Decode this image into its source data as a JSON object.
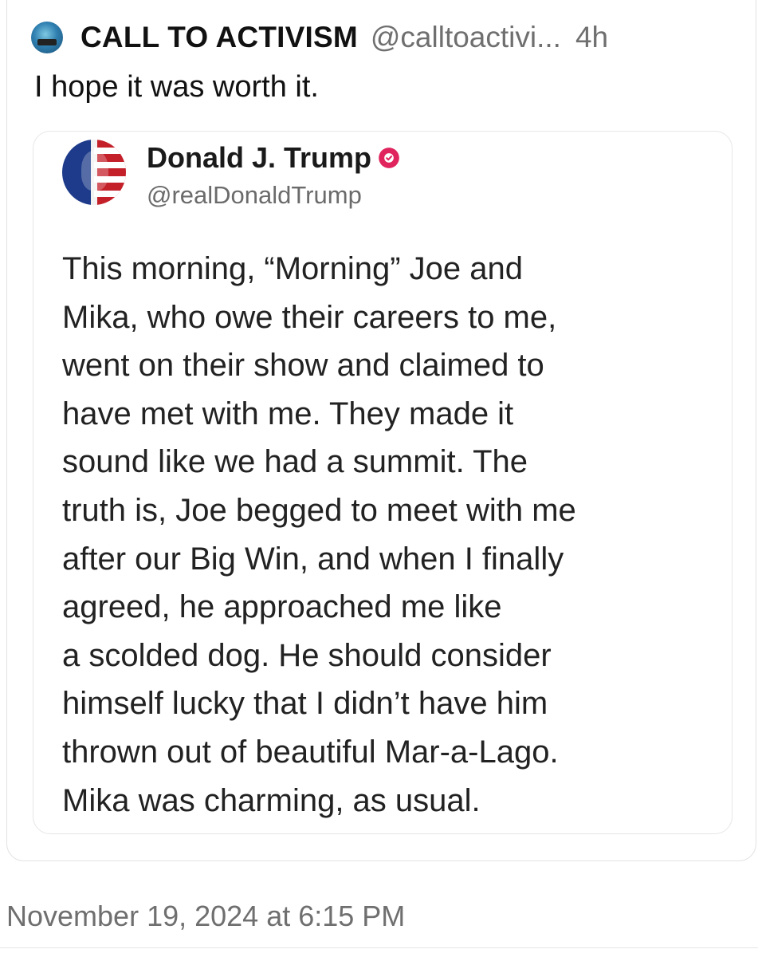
{
  "post": {
    "author_name": "CALL TO ACTIVISM",
    "author_handle": "@calltoactivi...",
    "time_ago": "4h",
    "text": "I hope it was worth it."
  },
  "quoted_post": {
    "author_name": "Donald J. Trump",
    "author_handle": "@realDonaldTrump",
    "body_lines": [
      "This morning, “Morning” Joe and",
      "Mika, who owe their careers to me,",
      "went on their show and claimed to",
      "have met with me. They made it",
      "sound like we had a summit. The",
      "truth is, Joe begged to meet with me",
      "after our Big Win, and when I finally",
      "agreed, he approached me like",
      "a scolded dog. He should consider",
      "himself lucky that I didn’t have him",
      "thrown out of beautiful Mar-a-Lago.",
      "Mika was charming, as usual."
    ]
  },
  "timestamp": "November 19, 2024 at 6:15 PM",
  "icons": {
    "author_avatar": "avatar-icon",
    "quoted_avatar": "flag-avatar-icon",
    "verified_badge": "verified-badge-icon"
  },
  "colors": {
    "verified_badge": "#e0245e",
    "secondary_text": "#6f6f6f",
    "border": "#e2e2e2"
  }
}
